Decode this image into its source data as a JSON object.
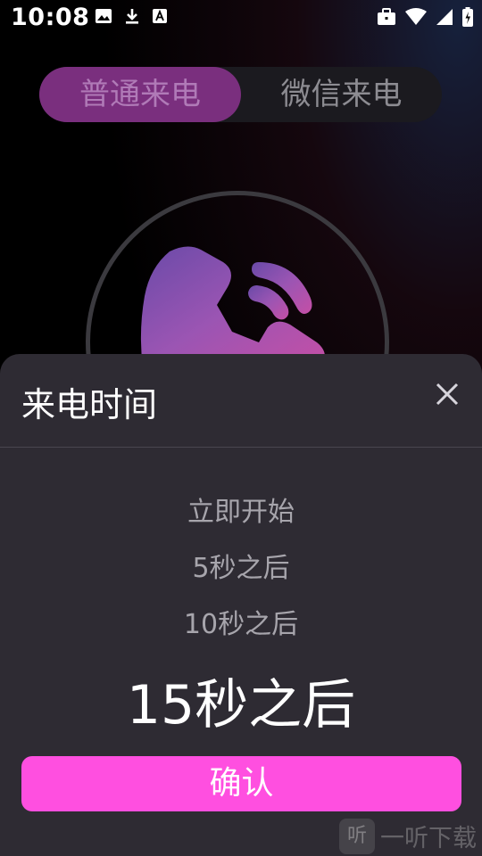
{
  "status_bar": {
    "time": "10:08"
  },
  "tabs": {
    "active": "普通来电",
    "inactive": "微信来电"
  },
  "sheet": {
    "title": "来电时间",
    "options": [
      "立即开始",
      "5秒之后",
      "10秒之后"
    ],
    "selected": "15秒之后",
    "confirm_label": "确认"
  },
  "watermark": {
    "logo": "听",
    "text": "一听下载"
  },
  "colors": {
    "accent": "#ff4fe0",
    "sheet_bg": "#2e2b33",
    "tab_active_bg": "#7a2f7e"
  }
}
